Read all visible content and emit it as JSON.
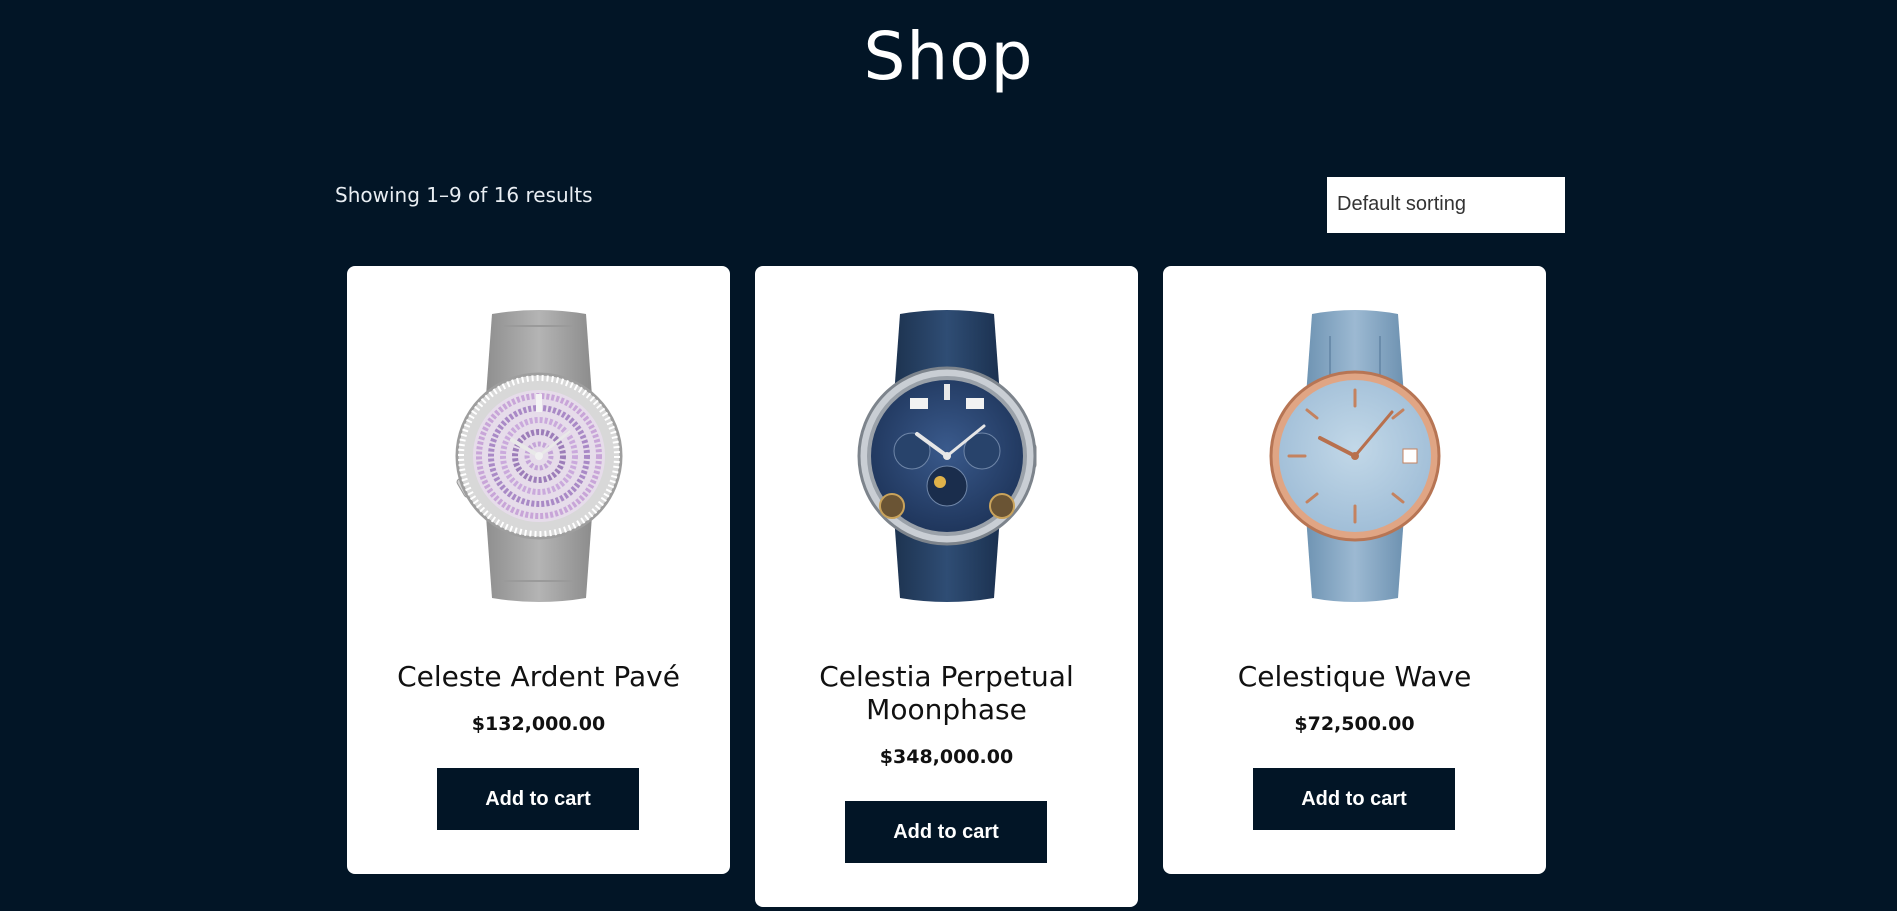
{
  "page": {
    "title": "Shop"
  },
  "toolbar": {
    "result_count": "Showing 1–9 of 16 results",
    "sort_selected": "Default sorting"
  },
  "products": [
    {
      "name": "Celeste Ardent Pavé",
      "price": "$132,000.00",
      "button": "Add to cart",
      "image": "watch-icon-diamond-pave"
    },
    {
      "name": "Celestia Perpetual Moonphase",
      "price": "$348,000.00",
      "button": "Add to cart",
      "image": "watch-icon-blue-moonphase"
    },
    {
      "name": "Celestique Wave",
      "price": "$72,500.00",
      "button": "Add to cart",
      "image": "watch-icon-rose-gold-blue"
    }
  ],
  "colors": {
    "background": "#021526",
    "card": "#ffffff",
    "button": "#021526",
    "button_text": "#ffffff"
  }
}
